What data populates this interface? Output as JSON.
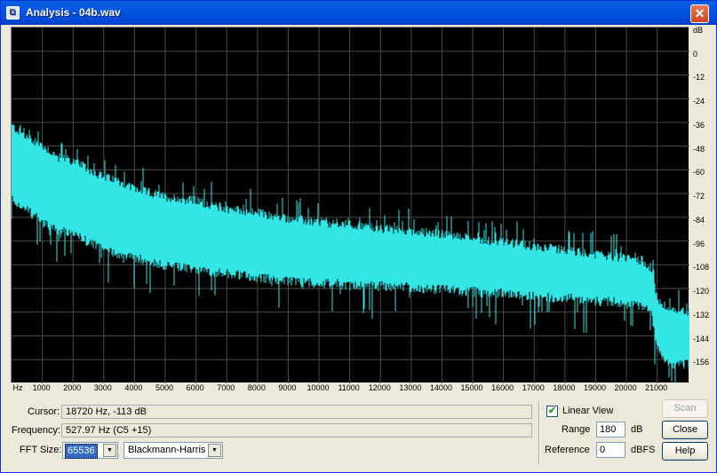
{
  "window": {
    "title": "Analysis - 04b.wav",
    "close_glyph": "✕",
    "icon": "app-icon"
  },
  "chart_data": {
    "type": "area",
    "title": "",
    "xlabel": "Hz",
    "ylabel": "dB",
    "x_ticks": [
      "Hz",
      "1000",
      "2000",
      "3000",
      "4000",
      "5000",
      "6000",
      "7000",
      "8000",
      "9000",
      "10000",
      "11000",
      "12000",
      "13000",
      "14000",
      "15000",
      "16000",
      "17000",
      "18000",
      "19000",
      "20000",
      "21000"
    ],
    "y_ticks": [
      "dB",
      "0",
      "-12",
      "-24",
      "-36",
      "-48",
      "-60",
      "-72",
      "-84",
      "-96",
      "-108",
      "-120",
      "-132",
      "-144",
      "-156"
    ],
    "xlim": [
      0,
      22050
    ],
    "ylim": [
      -168,
      12
    ],
    "grid": true,
    "series_color": "#33e6e6",
    "series": [
      {
        "x": [
          0,
          500,
          1000,
          1500,
          2000,
          2500,
          3000,
          3500,
          4000,
          4500,
          5000,
          5500,
          6000,
          6500,
          7000,
          7500,
          8000,
          8500,
          9000,
          9500,
          10000,
          10500,
          11000,
          11500,
          12000,
          12500,
          13000,
          13500,
          14000,
          14500,
          15000,
          15500,
          16000,
          16500,
          17000,
          17500,
          18000,
          18500,
          19000,
          19500,
          20000,
          20500,
          20800,
          21000,
          21300,
          21600,
          22050
        ],
        "peak": [
          -40,
          -46,
          -50,
          -56,
          -58,
          -62,
          -66,
          -68,
          -72,
          -74,
          -76,
          -77,
          -78,
          -80,
          -82,
          -83,
          -84,
          -86,
          -87,
          -88,
          -89,
          -90,
          -90,
          -91,
          -92,
          -93,
          -93,
          -94,
          -95,
          -96,
          -97,
          -98,
          -99,
          -100,
          -101,
          -102,
          -103,
          -104,
          -105,
          -106,
          -107,
          -108,
          -112,
          -128,
          -132,
          -134,
          -134
        ],
        "low": [
          -72,
          -78,
          -84,
          -88,
          -90,
          -94,
          -98,
          -100,
          -102,
          -104,
          -106,
          -107,
          -108,
          -109,
          -110,
          -111,
          -112,
          -113,
          -114,
          -114,
          -115,
          -115,
          -116,
          -116,
          -116,
          -117,
          -117,
          -118,
          -118,
          -119,
          -119,
          -120,
          -120,
          -121,
          -121,
          -122,
          -122,
          -123,
          -124,
          -124,
          -125,
          -126,
          -130,
          -148,
          -154,
          -156,
          -156
        ]
      }
    ]
  },
  "controls": {
    "cursor_label": "Cursor:",
    "cursor_value": "18720 Hz,   -113 dB",
    "frequency_label": "Frequency:",
    "frequency_value": "527.97 Hz (C5 +15)",
    "fft_label": "FFT Size:",
    "fft_value": "65536",
    "window_value": "Blackmann-Harris",
    "linear_view_label": "Linear View",
    "linear_view_checked": "✔",
    "range_label": "Range",
    "range_value": "180",
    "range_unit": "dB",
    "reference_label": "Reference",
    "reference_value": "0",
    "reference_unit": "dBFS",
    "scan_label": "Scan",
    "close_label": "Close",
    "help_label": "Help"
  }
}
